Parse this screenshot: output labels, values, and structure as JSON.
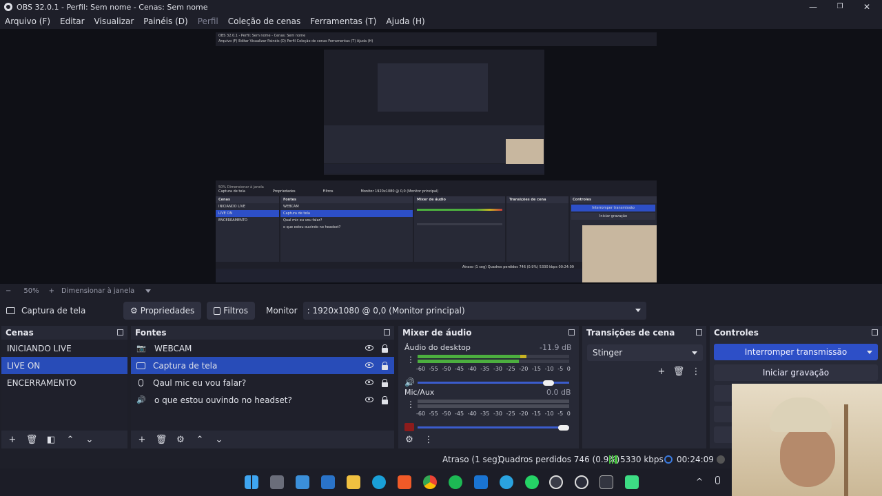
{
  "window": {
    "title": "OBS 32.0.1 - Perfil: Sem nome - Cenas: Sem nome",
    "minimize": "—",
    "maximize": "❐",
    "close": "✕"
  },
  "menu": [
    {
      "label": "Arquivo (F)",
      "disabled": false
    },
    {
      "label": "Editar",
      "disabled": false
    },
    {
      "label": "Visualizar",
      "disabled": false
    },
    {
      "label": "Painéis (D)",
      "disabled": false
    },
    {
      "label": "Perfil",
      "disabled": true
    },
    {
      "label": "Coleção de cenas",
      "disabled": false
    },
    {
      "label": "Ferramentas (T)",
      "disabled": false
    },
    {
      "label": "Ajuda (H)",
      "disabled": false
    }
  ],
  "nested": {
    "title": "OBS 32.0.1 - Perfil: Sem nome - Cenas: Sem nome",
    "menu": "Arquivo (F)   Editar   Visualizar   Painéis (D)   Perfil   Coleção de cenas   Ferramentas (T)   Ajuda (H)",
    "scenes_header": "Cenas",
    "scenes": [
      "INICIANDO LIVE",
      "LIVE ON",
      "ENCERRAMENTO"
    ],
    "sources_header": "Fontes",
    "sources": [
      "WEBCAM",
      "Captura de tela",
      "Qual mic eu vou falar?",
      "o que estou ouvindo no headset?"
    ],
    "mixer_header": "Mixer de áudio",
    "transitions_header": "Transições de cena",
    "controls_header": "Controles",
    "stop_stream": "Interromper transmissão",
    "start_rec": "Iniciar gravação",
    "status": "Atraso (1 seg)   Quadros perdidos 746 (0.9%)   5330 kbps   00:24:09",
    "zoom": "50%   Dimensionar à janela",
    "source_label": "Captura de tela",
    "props": "Propriedades",
    "filters": "Filtros",
    "monitor": "Monitor   1920x1080 @ 0,0 (Monitor principal)"
  },
  "zoombar": {
    "minus": "−",
    "zoom": "50%",
    "plus": "+",
    "fit": "Dimensionar à janela"
  },
  "source_toolbar": {
    "name": "Captura de tela",
    "properties": "Propriedades",
    "filters": "Filtros",
    "monitor_label": "Monitor",
    "monitor_value": ": 1920x1080 @ 0,0 (Monitor principal)"
  },
  "scenes": {
    "header": "Cenas",
    "items": [
      "INICIANDO LIVE",
      "LIVE ON",
      "ENCERRAMENTO"
    ],
    "selected_index": 1
  },
  "sources": {
    "header": "Fontes",
    "items": [
      {
        "label": "WEBCAM",
        "icon": "camera-icon"
      },
      {
        "label": "Captura de tela",
        "icon": "monitor-icon"
      },
      {
        "label": "Qaul mic eu vou falar?",
        "icon": "microphone-icon"
      },
      {
        "label": "o que estou ouvindo no headset?",
        "icon": "speaker-icon"
      }
    ],
    "selected_index": 1
  },
  "mixer": {
    "header": "Mixer de áudio",
    "ticks": [
      "-60",
      "-55",
      "-50",
      "-45",
      "-40",
      "-35",
      "-30",
      "-25",
      "-20",
      "-15",
      "-10",
      "-5",
      "0"
    ],
    "channels": [
      {
        "name": "Áudio do desktop",
        "db": "-11.9 dB",
        "level": 0.72,
        "volume": 0.9,
        "muted": false
      },
      {
        "name": "Mic/Aux",
        "db": "0.0 dB",
        "level": 0.0,
        "volume": 1.0,
        "muted": true
      }
    ]
  },
  "transitions": {
    "header": "Transições de cena",
    "selected": "Stinger"
  },
  "controls": {
    "header": "Controles",
    "stop_stream": "Interromper transmissão",
    "start_recording": "Iniciar gravação"
  },
  "status": {
    "delay": "Atraso (1 seg)",
    "dropped": "Quadros perdidos 746 (0.9%)",
    "bitrate": "5330 kbps",
    "time": "00:24:09"
  },
  "colors": {
    "accent": "#284cb8",
    "meter_green": "#4caf3f",
    "meter_yellow": "#c8b322",
    "meter_red": "#c23b3b",
    "bitrate_green": "#48c040"
  },
  "taskbar_icons": [
    "windows-start-icon",
    "calculator-icon",
    "notepad-icon",
    "store-icon",
    "folder-icon",
    "edge-icon",
    "brave-icon",
    "chrome-icon",
    "spotify-icon",
    "outlook-icon",
    "telegram-icon",
    "whatsapp-icon",
    "obs-icon",
    "media-player-icon",
    "terminal-icon",
    "android-icon"
  ]
}
